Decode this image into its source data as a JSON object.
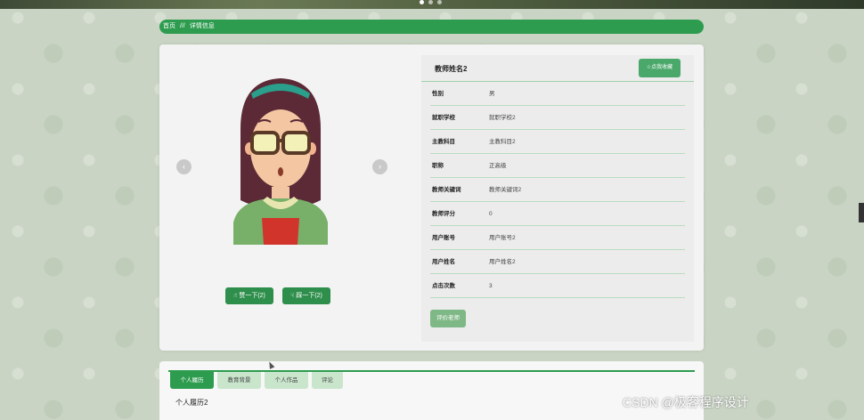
{
  "banner": {
    "dots": 3
  },
  "breadcrumb": {
    "home": "首页",
    "separator": "///",
    "current": "详情信息"
  },
  "nav": {
    "prev_icon": "chevron-left-icon",
    "next_icon": "chevron-right-icon",
    "prev": "‹",
    "next": "›"
  },
  "votes": {
    "like_label": "☝ 赞一下(2)",
    "dislike_label": "☟ 踩一下(2)"
  },
  "teacher": {
    "name": "教师姓名2",
    "favorite_label": "☆点我收藏",
    "fields": [
      {
        "label": "性别",
        "value": "男"
      },
      {
        "label": "就职学校",
        "value": "就职学校2"
      },
      {
        "label": "主教科目",
        "value": "主教科目2"
      },
      {
        "label": "职称",
        "value": "正高级"
      },
      {
        "label": "教师关键词",
        "value": "教师关键词2"
      },
      {
        "label": "教师评分",
        "value": "0"
      },
      {
        "label": "用户账号",
        "value": "用户账号2"
      },
      {
        "label": "用户姓名",
        "value": "用户姓名2"
      },
      {
        "label": "点击次数",
        "value": "3"
      }
    ],
    "rate_label": "评价老师"
  },
  "tabs": {
    "items": [
      "个人履历",
      "教育背景",
      "个人作品",
      "评论"
    ],
    "active": "个人履历",
    "content": "个人履历2"
  },
  "watermark": "CSDN @极客程序设计",
  "colors": {
    "primary": "#2e9c4f",
    "light": "#c9e6cd",
    "rate": "#7fb887"
  }
}
